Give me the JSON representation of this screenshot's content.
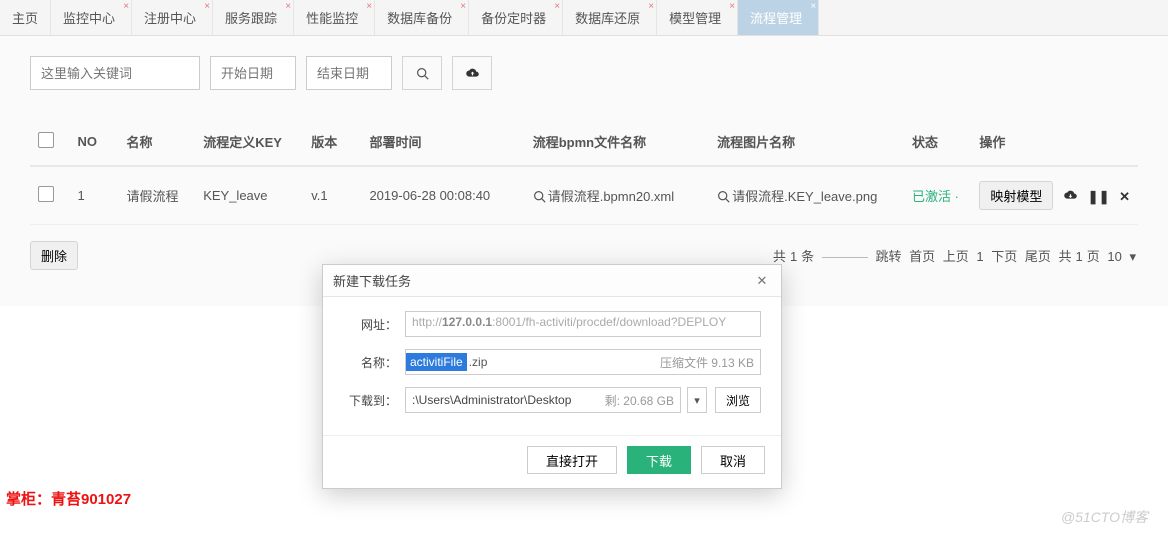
{
  "tabs": [
    {
      "label": "主页",
      "closable": false,
      "active": false
    },
    {
      "label": "监控中心",
      "closable": true,
      "active": false
    },
    {
      "label": "注册中心",
      "closable": true,
      "active": false
    },
    {
      "label": "服务跟踪",
      "closable": true,
      "active": false
    },
    {
      "label": "性能监控",
      "closable": true,
      "active": false
    },
    {
      "label": "数据库备份",
      "closable": true,
      "active": false
    },
    {
      "label": "备份定时器",
      "closable": true,
      "active": false
    },
    {
      "label": "数据库还原",
      "closable": true,
      "active": false
    },
    {
      "label": "模型管理",
      "closable": true,
      "active": false
    },
    {
      "label": "流程管理",
      "closable": true,
      "active": true
    }
  ],
  "toolbar": {
    "keyword_placeholder": "这里输入关键词",
    "start_date_placeholder": "开始日期",
    "end_date_placeholder": "结束日期"
  },
  "table": {
    "headers": {
      "no": "NO",
      "name": "名称",
      "defkey": "流程定义KEY",
      "version": "版本",
      "deploy_time": "部署时间",
      "bpmn_file": "流程bpmn文件名称",
      "image_file": "流程图片名称",
      "status": "状态",
      "op": "操作"
    },
    "rows": [
      {
        "no": "1",
        "name": "请假流程",
        "defkey": "KEY_leave",
        "version": "v.1",
        "deploy_time": "2019-06-28 00:08:40",
        "bpmn_file": "请假流程.bpmn20.xml",
        "image_file": "请假流程.KEY_leave.png",
        "status": "已激活",
        "op_label": "映射模型"
      }
    ]
  },
  "footer": {
    "delete_label": "删除",
    "total_prefix": "共",
    "total_count": "1",
    "total_suffix": "条",
    "jump": "跳转",
    "first": "首页",
    "prev": "上页",
    "cur": "1",
    "next": "下页",
    "last": "尾页",
    "pages_prefix": "共",
    "pages": "1",
    "pages_suffix": "页",
    "size": "10"
  },
  "dialog": {
    "title": "新建下载任务",
    "url_label": "网址：",
    "url_prefix": "http://",
    "url_host": "127.0.0.1",
    "url_rest": ":8001/fh-activiti/procdef/download?DEPLOY",
    "name_label": "名称：",
    "name_selected": "activitiFile",
    "name_ext": ".zip",
    "name_meta": "压缩文件 9.13 KB",
    "path_label": "下载到：",
    "path_value": ":\\Users\\Administrator\\Desktop",
    "path_free": "剩: 20.68 GB",
    "browse_label": "浏览",
    "btn_open": "直接打开",
    "btn_download": "下载",
    "btn_cancel": "取消"
  },
  "credit": "掌柜：青苔901027",
  "watermark": "@51CTO博客"
}
